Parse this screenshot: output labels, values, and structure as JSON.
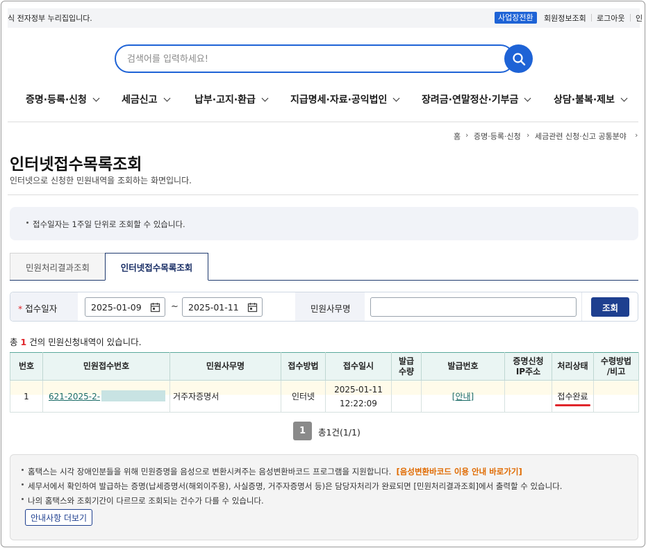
{
  "topbar": {
    "notice": "식 전자정부 누리집입니다.",
    "biz_switch": "사업장전환",
    "member_info": "회원정보조회",
    "logout": "로그아웃",
    "truncated": "인"
  },
  "search": {
    "placeholder": "검색어를 입력하세요!",
    "icon": "search-icon"
  },
  "gnb": [
    {
      "label": "증명·등록·신청"
    },
    {
      "label": "세금신고"
    },
    {
      "label": "납부·고지·환급"
    },
    {
      "label": "지급명세·자료·공익법인"
    },
    {
      "label": "장려금·연말정산·기부금"
    },
    {
      "label": "상담·불복·제보"
    }
  ],
  "breadcrumb": [
    "홈",
    "증명·등록·신청",
    "세금관련 신청·신고 공통분야"
  ],
  "page": {
    "title": "인터넷접수목록조회",
    "subtitle": "인터넷으로 신청한 민원내역을 조회하는 화면입니다."
  },
  "info": "접수일자는 1주일 단위로 조회할 수 있습니다.",
  "tabs": [
    {
      "label": "민원처리결과조회",
      "active": false
    },
    {
      "label": "인터넷접수목록조회",
      "active": true
    }
  ],
  "filter": {
    "date_label": "접수일자",
    "required_mark": "*",
    "date_from": "2025-01-09",
    "tilde": "~",
    "date_to": "2025-01-11",
    "civil_label": "민원사무명",
    "civil_value": "",
    "query_button": "조회"
  },
  "summary": {
    "prefix": "총",
    "count": "1",
    "suffix": "건의 민원신청내역이 있습니다."
  },
  "table": {
    "headers": [
      "번호",
      "민원접수번호",
      "민원사무명",
      "접수방법",
      "접수일시",
      "발급\n수량",
      "발급번호",
      "증명신청\nIP주소",
      "처리상태",
      "수령방법\n/비고"
    ],
    "rows": [
      {
        "no": "1",
        "receipt_no": "621-2025-2-",
        "civil_name": "거주자증명서",
        "method": "인터넷",
        "date": "2025-01-11",
        "time": "12:22:09",
        "qty": "",
        "issue_no": "[안내]",
        "ip": "",
        "status": "접수완료",
        "receive": ""
      }
    ]
  },
  "pager": {
    "current": "1",
    "total": "총1건(1/1)"
  },
  "notes": {
    "line1": "홈택스는 시각 장애인분들을 위해 민원증명을 음성으로 변환시켜주는 음성변환바코드 프로그램을 지원합니다.",
    "line1_link": "[음성변환바코드 이용 안내 바로가기]",
    "line2": "세무서에서 확인하여 발급하는 증명(납세증명서(해외이주용), 사실증명, 거주자증명서 등)은 담당자처리가 완료되면 [민원처리결과조회]에서 출력할 수 있습니다.",
    "line3": "나의 홈택스와 조회기간이 다르므로 조회되는 건수가 다를 수 있습니다.",
    "more_button": "안내사항 더보기"
  },
  "colors": {
    "primary": "#1e63d6",
    "navy": "#1e3f8f",
    "required": "#e0262b",
    "link": "#1a6b66",
    "orange": "#e06a00"
  }
}
